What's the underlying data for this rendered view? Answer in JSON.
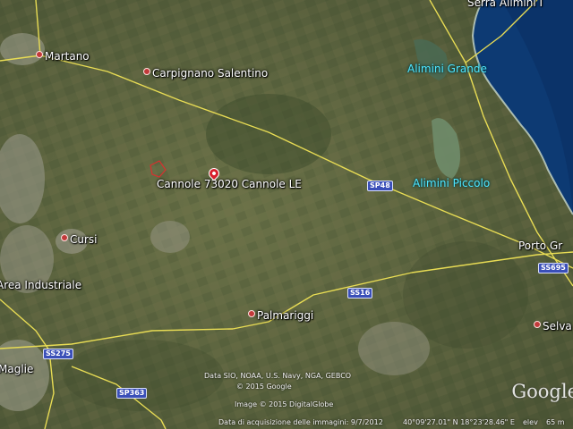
{
  "places": [
    {
      "id": "martano",
      "label": "Martano",
      "dot": true,
      "water": false
    },
    {
      "id": "carpignano",
      "label": "Carpignano Salentino",
      "dot": true,
      "water": false
    },
    {
      "id": "cannole",
      "label": "Cannole 73020 Cannole LE",
      "dot": false,
      "water": false
    },
    {
      "id": "cursi",
      "label": "Cursi",
      "dot": true,
      "water": false
    },
    {
      "id": "area_ind",
      "label": "Area Industriale",
      "dot": false,
      "water": false
    },
    {
      "id": "palmariggi",
      "label": "Palmariggi",
      "dot": true,
      "water": false
    },
    {
      "id": "maglie",
      "label": "Maglie",
      "dot": false,
      "water": false
    },
    {
      "id": "selva",
      "label": "Selva",
      "dot": true,
      "water": false
    },
    {
      "id": "porto",
      "label": "Porto Gr",
      "dot": false,
      "water": false
    },
    {
      "id": "alimini_g",
      "label": "Alimini Grande",
      "dot": false,
      "water": true
    },
    {
      "id": "alimini_p",
      "label": "Alimini Piccolo",
      "dot": false,
      "water": true
    },
    {
      "id": "serra",
      "label": "Serra Alimini I",
      "dot": false,
      "water": false
    }
  ],
  "roads": [
    {
      "id": "sp48",
      "label": "SP48"
    },
    {
      "id": "ss16",
      "label": "SS16"
    },
    {
      "id": "ss275",
      "label": "SS275"
    },
    {
      "id": "sp363",
      "label": "SP363"
    },
    {
      "id": "ss695",
      "label": "SS695"
    }
  ],
  "attribution": {
    "line1": "Data SIO, NOAA, U.S. Navy, NGA, GEBCO",
    "line2": "© 2015 Google",
    "line3": "Image © 2015 DigitalGlobe"
  },
  "status": {
    "acquisition": "Data di acquisizione delle immagini: 9/7/2012",
    "coords": "40°09'27.01\" N   18°23'28.46\" E",
    "elev_label": "elev",
    "elev_value": "65 m"
  },
  "logo": "Google",
  "colors": {
    "terrain": "#5a6340",
    "road": "#e8dc54",
    "sea": "#0d3a73",
    "label_water": "#4fe6ff",
    "shield": "#3a4fb8"
  }
}
